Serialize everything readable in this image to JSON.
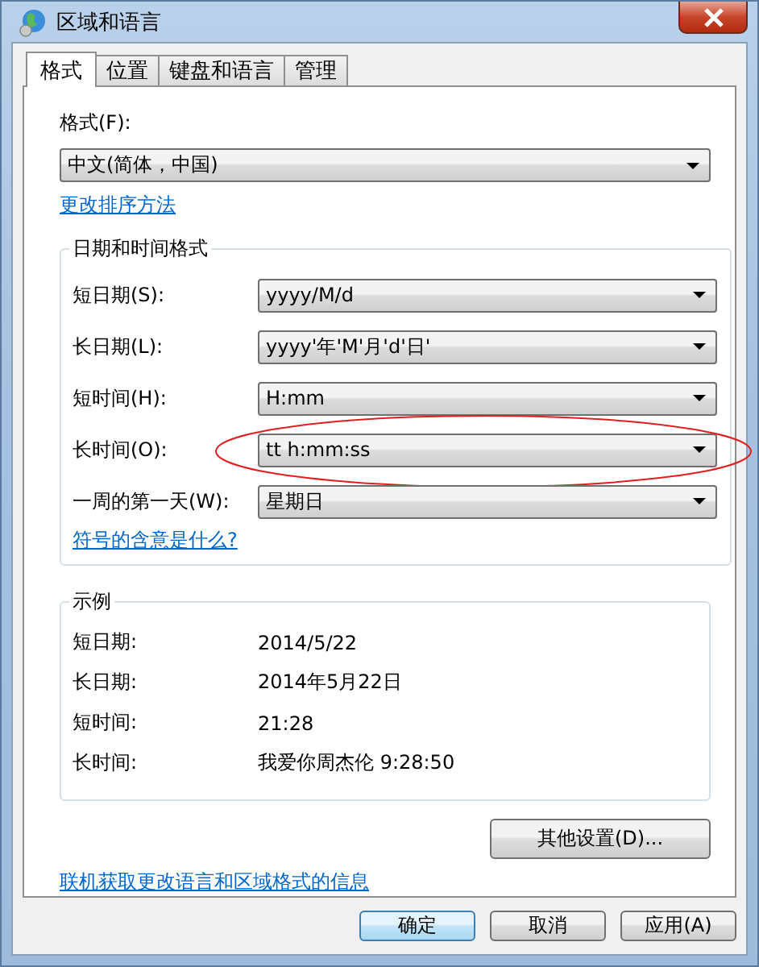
{
  "window": {
    "title": "区域和语言"
  },
  "tabs": [
    {
      "label": "格式",
      "selected": true
    },
    {
      "label": "位置",
      "selected": false
    },
    {
      "label": "键盘和语言",
      "selected": false
    },
    {
      "label": "管理",
      "selected": false
    }
  ],
  "format": {
    "label": "格式(F):",
    "value": "中文(简体，中国)",
    "link": "更改排序方法"
  },
  "datetime_group": {
    "title": "日期和时间格式",
    "rows": [
      {
        "label": "短日期(S):",
        "value": "yyyy/M/d",
        "circled": false
      },
      {
        "label": "长日期(L):",
        "value": "yyyy'年'M'月'd'日'",
        "circled": false
      },
      {
        "label": "短时间(H):",
        "value": "H:mm",
        "circled": false
      },
      {
        "label": "长时间(O):",
        "value": "tt h:mm:ss",
        "circled": true
      },
      {
        "label": "一周的第一天(W):",
        "value": "星期日",
        "circled": false
      }
    ],
    "link": "符号的含意是什么?"
  },
  "example_group": {
    "title": "示例",
    "rows": [
      {
        "label": "短日期:",
        "value": "2014/5/22"
      },
      {
        "label": "长日期:",
        "value": "2014年5月22日"
      },
      {
        "label": "短时间:",
        "value": "21:28"
      },
      {
        "label": "长时间:",
        "value": "我爱你周杰伦 9:28:50"
      }
    ]
  },
  "other_settings_button": "其他设置(D)...",
  "online_link": "联机获取更改语言和区域格式的信息",
  "buttons": [
    {
      "label": "确定",
      "default": true
    },
    {
      "label": "取消",
      "default": false
    },
    {
      "label": "应用(A)",
      "default": false
    }
  ]
}
